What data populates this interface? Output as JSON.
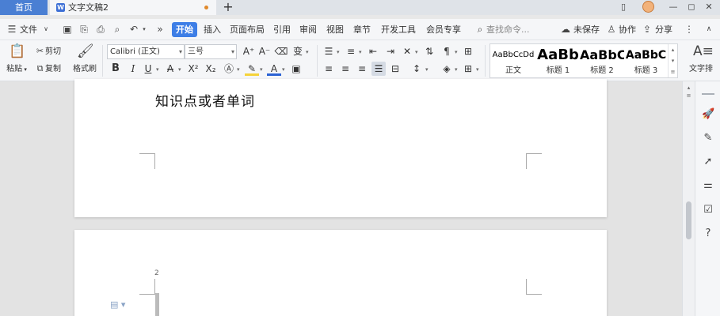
{
  "tabs": {
    "home": "首页",
    "doc_logo": "W",
    "doc_title": "文字文稿2",
    "new_tab": "+"
  },
  "window": {
    "icons": [
      "layout-icon",
      "avatar",
      "minimize-icon",
      "restore-icon",
      "close-icon"
    ]
  },
  "menu": {
    "file": "文件",
    "items": [
      "开始",
      "插入",
      "页面布局",
      "引用",
      "审阅",
      "视图",
      "章节",
      "开发工具",
      "会员专享"
    ],
    "search_placeholder": "查找命令...",
    "unsaved": "未保存",
    "collab": "协作",
    "share": "分享"
  },
  "ribbon": {
    "paste": "粘贴",
    "cut": "剪切",
    "copy": "复制",
    "format_painter": "格式刷",
    "font_name": "Calibri (正文)",
    "font_size": "三号",
    "text_direction": "文字排"
  },
  "styles": [
    {
      "preview": "AaBbCcDd",
      "name": "正文"
    },
    {
      "preview": "AaBb",
      "name": "标题 1"
    },
    {
      "preview": "AaBbC",
      "name": "标题 2"
    },
    {
      "preview": "AaBbC",
      "name": "标题 3"
    }
  ],
  "document": {
    "text": "知识点或者单词",
    "page2_number": "2"
  },
  "colors": {
    "accent": "#3d7ee6",
    "home_tab": "#4a7fd3"
  }
}
